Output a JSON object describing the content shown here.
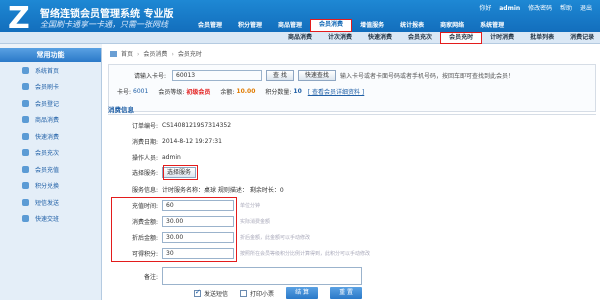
{
  "header": {
    "logo_mark": "Z",
    "title": "智络连锁会员管理系统 专业版",
    "slogan": "全国刷卡通享一卡通，只需一张网线",
    "user": "admin",
    "top_links": [
      "你好",
      "修改密码",
      "帮助",
      "退出"
    ]
  },
  "main_nav": [
    "会员管理",
    "积分管理",
    "商品管理",
    "会员消费",
    "增值服务",
    "统计报表",
    "商家网络",
    "系统管理"
  ],
  "sub_nav": [
    "商品消费",
    "计次消费",
    "快速消费",
    "会员充次",
    "会员充时",
    "计时消费",
    "批单列表",
    "消费记录"
  ],
  "sidebar": {
    "title": "常用功能",
    "items": [
      "系统首页",
      "会员刷卡",
      "会员登记",
      "商品消费",
      "快速消费",
      "会员充次",
      "会员充值",
      "积分兑换",
      "短信发送",
      "快速交班"
    ]
  },
  "breadcrumb": [
    "首页",
    "会员消费",
    "会员充时"
  ],
  "card": {
    "label": "请输入卡号:",
    "value": "60013",
    "search_btn": "查 找",
    "quick_btn": "快速查找",
    "hint": "输入卡号或者卡面号码或者手机号码，按回车即可查找到此会员！"
  },
  "member": {
    "card_label": "卡号:",
    "card": "6001",
    "level_label": "会员等级:",
    "level": "初级会员",
    "balance_label": "余额:",
    "balance": "10.00",
    "points_label": "积分数量:",
    "points": "10",
    "detail_link": "[ 查看会员详细资料 ]"
  },
  "section_title": "消费信息",
  "form": {
    "order_label": "订单编号:",
    "order": "CS14081219S7314352",
    "date_label": "消费日期:",
    "date": "2014-8-12 19:27:31",
    "operator_label": "操作人员:",
    "operator": "admin",
    "select_label": "选择服务:",
    "select_btn": "选择服务",
    "service_label": "服务信息:",
    "service": "计时服务名称：桌球  规则描述：  剩余时长：0",
    "recharge_label": "充值时间:",
    "recharge": "60",
    "recharge_tip": "单位分钟",
    "amount_label": "消费金额:",
    "amount": "30.00",
    "amount_tip": "实际消费金额",
    "discount_label": "折后金额:",
    "discount": "30.00",
    "discount_tip": "折后金额，此金额可以手动修改",
    "points_label": "可得积分:",
    "points": "30",
    "points_tip": "按照所在会员等级积分比例计算得到，此积分可以手动修改",
    "remark_label": "备注:"
  },
  "bottom": {
    "sms": "发送短信",
    "print": "打印小票",
    "submit": "结 算",
    "reset": "重 置"
  },
  "colors": {
    "accent": "#1e88d4",
    "highlight": "#e31c1c"
  }
}
